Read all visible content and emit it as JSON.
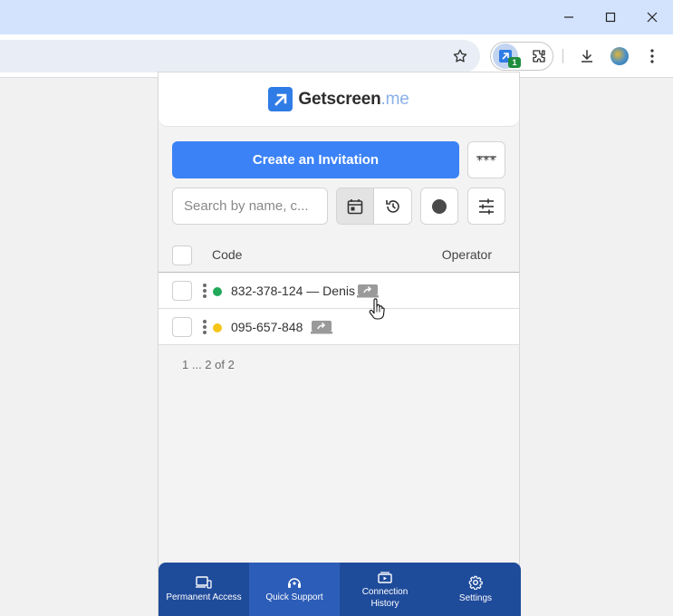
{
  "browser": {
    "extension_badge": "1"
  },
  "popup": {
    "logo": {
      "name": "Getscreen",
      "suffix": ".me"
    },
    "create_button": "Create an Invitation",
    "search": {
      "placeholder": "Search by name, c...",
      "value": ""
    },
    "table": {
      "headers": {
        "code": "Code",
        "operator": "Operator"
      },
      "rows": [
        {
          "code": "832-378-124 — Denis",
          "status_color": "#22a95a"
        },
        {
          "code": "095-657-848",
          "status_color": "#f5c518"
        }
      ]
    },
    "pagination": "1 ... 2 of 2",
    "nav": [
      {
        "label": "Permanent Access",
        "icon": "devices-icon"
      },
      {
        "label": "Quick Support",
        "icon": "support-icon",
        "active": true
      },
      {
        "label": "Connection History",
        "icon": "history-icon"
      },
      {
        "label": "Settings",
        "icon": "gear-icon"
      }
    ]
  },
  "colors": {
    "accent": "#3b82f6",
    "nav_bg": "#1f4b9b",
    "nav_active": "#2c5db8",
    "titlebar": "#d3e3fd"
  }
}
